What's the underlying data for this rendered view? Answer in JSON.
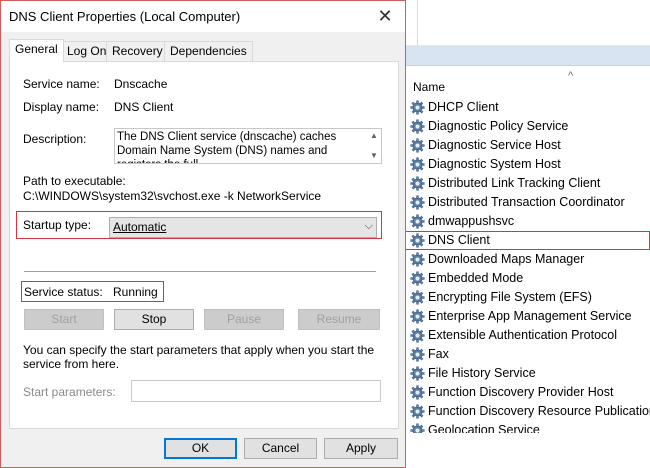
{
  "dialog": {
    "title": "DNS Client Properties (Local Computer)",
    "tabs": [
      "General",
      "Log On",
      "Recovery",
      "Dependencies"
    ],
    "service_name_label": "Service name:",
    "service_name_value": "Dnscache",
    "display_name_label": "Display name:",
    "display_name_value": "DNS Client",
    "description_label": "Description:",
    "description_value": "The DNS Client service (dnscache) caches Domain Name System (DNS) names and registers the full",
    "path_label": "Path to executable:",
    "path_value": "C:\\WINDOWS\\system32\\svchost.exe -k NetworkService",
    "startup_type_label": "Startup type:",
    "startup_type_value": "Automatic",
    "service_status_label": "Service status:",
    "service_status_value": "Running",
    "buttons": {
      "start": "Start",
      "stop": "Stop",
      "pause": "Pause",
      "resume": "Resume"
    },
    "help_text": "You can specify the start parameters that apply when you start the service from here.",
    "start_params_label": "Start parameters:",
    "start_params_value": "",
    "ok": "OK",
    "cancel": "Cancel",
    "apply": "Apply",
    "close_glyph": "✕"
  },
  "services": {
    "column_header": "Name",
    "sort_glyph": "^",
    "items": [
      "DHCP Client",
      "Diagnostic Policy Service",
      "Diagnostic Service Host",
      "Diagnostic System Host",
      "Distributed Link Tracking Client",
      "Distributed Transaction Coordinator",
      "dmwappushsvc",
      "DNS Client",
      "Downloaded Maps Manager",
      "Embedded Mode",
      "Encrypting File System (EFS)",
      "Enterprise App Management Service",
      "Extensible Authentication Protocol",
      "Fax",
      "File History Service",
      "Function Discovery Provider Host",
      "Function Discovery Resource Publication",
      "Geolocation Service"
    ],
    "selected": "DNS Client",
    "icon": "gear-icon"
  }
}
